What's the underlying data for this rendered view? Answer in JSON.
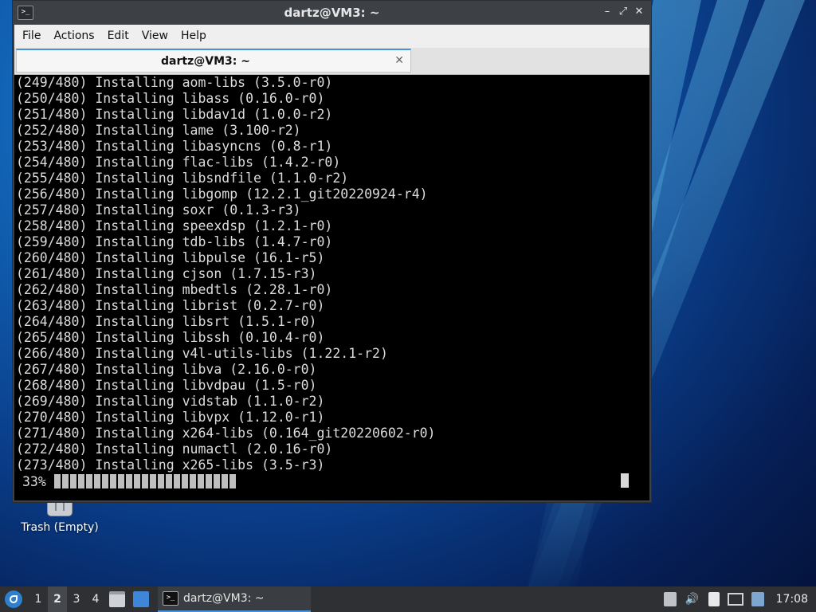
{
  "window": {
    "title": "dartz@VM3: ~",
    "app_icon_glyph": ">_",
    "controls": {
      "minimize": "–",
      "maximize": "⤢",
      "close": "✕"
    }
  },
  "menu": [
    "File",
    "Actions",
    "Edit",
    "View",
    "Help"
  ],
  "tab": {
    "label": "dartz@VM3: ~",
    "close": "✕"
  },
  "terminal": {
    "lines": [
      "(249/480) Installing aom-libs (3.5.0-r0)",
      "(250/480) Installing libass (0.16.0-r0)",
      "(251/480) Installing libdav1d (1.0.0-r2)",
      "(252/480) Installing lame (3.100-r2)",
      "(253/480) Installing libasyncns (0.8-r1)",
      "(254/480) Installing flac-libs (1.4.2-r0)",
      "(255/480) Installing libsndfile (1.1.0-r2)",
      "(256/480) Installing libgomp (12.2.1_git20220924-r4)",
      "(257/480) Installing soxr (0.1.3-r3)",
      "(258/480) Installing speexdsp (1.2.1-r0)",
      "(259/480) Installing tdb-libs (1.4.7-r0)",
      "(260/480) Installing libpulse (16.1-r5)",
      "(261/480) Installing cjson (1.7.15-r3)",
      "(262/480) Installing mbedtls (2.28.1-r0)",
      "(263/480) Installing librist (0.2.7-r0)",
      "(264/480) Installing libsrt (1.5.1-r0)",
      "(265/480) Installing libssh (0.10.4-r0)",
      "(266/480) Installing v4l-utils-libs (1.22.1-r2)",
      "(267/480) Installing libva (2.16.0-r0)",
      "(268/480) Installing libvdpau (1.5-r0)",
      "(269/480) Installing vidstab (1.1.0-r2)",
      "(270/480) Installing libvpx (1.12.0-r1)",
      "(271/480) Installing x264-libs (0.164_git20220602-r0)",
      "(272/480) Installing numactl (2.0.16-r0)",
      "(273/480) Installing x265-libs (3.5-r3)"
    ],
    "progress_text": "33%",
    "progress_blocks": 23
  },
  "desktop": {
    "trash_label": "Trash (Empty)"
  },
  "taskbar": {
    "workspaces": [
      "1",
      "2",
      "3",
      "4"
    ],
    "active_workspace": "2",
    "task_label": "dartz@VM3: ~",
    "clock": "17:08",
    "volume_glyph": "🔊"
  },
  "colors": {
    "accent": "#4a90d9",
    "terminal_bg": "#000000",
    "terminal_fg": "#dcdcdc",
    "taskbar_bg": "#2e3033"
  }
}
